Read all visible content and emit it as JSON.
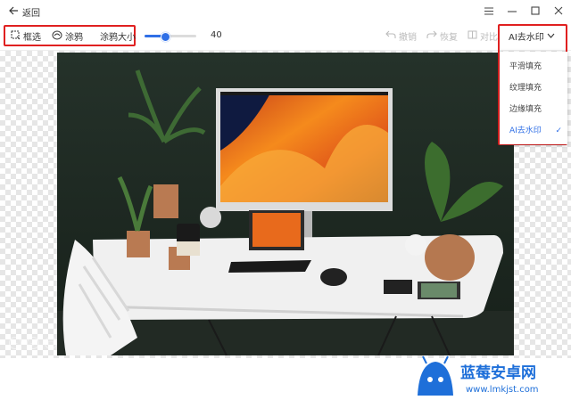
{
  "titlebar": {
    "back_label": "返回"
  },
  "toolbar": {
    "box_select_label": "框选",
    "brush_label": "涂鸦",
    "brush_size_label": "涂鸦大小",
    "brush_size_value": "40",
    "brush_size_fraction": 0.4,
    "undo_label": "撤销",
    "redo_label": "恢复",
    "compare_label": "对比",
    "fill_mode_label": "AI去水印"
  },
  "dropdown": {
    "items": [
      {
        "label": "平滑填充",
        "selected": false
      },
      {
        "label": "纹理填充",
        "selected": false
      },
      {
        "label": "边缘填充",
        "selected": false
      },
      {
        "label": "AI去水印",
        "selected": true
      }
    ]
  },
  "watermark": {
    "brand": "蓝莓安卓网",
    "url": "www.lmkjst.com"
  },
  "colors": {
    "accent": "#2f6fe6",
    "highlight_box": "#e02020"
  }
}
